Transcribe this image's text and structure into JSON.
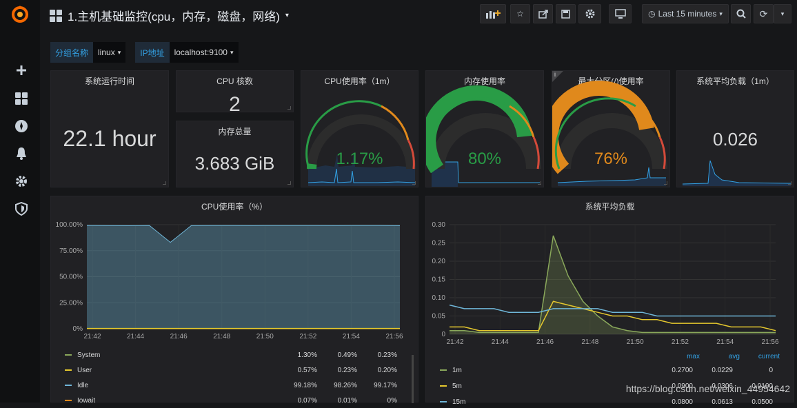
{
  "dashboard": {
    "title": "1.主机基础监控(cpu，内存，磁盘，网络)",
    "time_range": "Last 15 minutes"
  },
  "variables": [
    {
      "label": "分组名称",
      "value": "linux"
    },
    {
      "label": "IP地址",
      "value": "localhost:9100"
    }
  ],
  "stats": {
    "uptime": {
      "title": "系统运行时间",
      "value": "22.1 hour"
    },
    "cpu_count": {
      "title": "CPU 核数",
      "value": "2"
    },
    "mem_total": {
      "title": "内存总量",
      "value": "3.683 GiB"
    },
    "cpu_usage": {
      "title": "CPU使用率（1m）",
      "value": "1.17%",
      "fraction": 0.0117,
      "color": "#299c46"
    },
    "mem_usage": {
      "title": "内存使用率",
      "value": "80%",
      "fraction": 0.8,
      "color": "#299c46"
    },
    "disk_usage": {
      "title": "最大分区(/)使用率",
      "value": "76%",
      "fraction": 0.76,
      "color": "#e0891c"
    },
    "load_avg": {
      "title": "系统平均负载（1m）",
      "value": "0.026"
    }
  },
  "colors": {
    "green": "#299c46",
    "orange": "#e0891c",
    "red": "#d44a3a",
    "blue": "#33a2e5",
    "yellow": "#e5c82e",
    "light_green": "#8aa85b",
    "light_blue": "#6fb6d8"
  },
  "chart_cpu": {
    "title": "CPU使用率（%）",
    "chart_data": {
      "type": "line",
      "x": [
        "21:42",
        "21:44",
        "21:46",
        "21:48",
        "21:50",
        "21:52",
        "21:54",
        "21:56"
      ],
      "ylim": [
        0,
        100
      ],
      "y_ticks": [
        "0%",
        "25.00%",
        "50.00%",
        "75.00%",
        "100.00%"
      ],
      "series": [
        {
          "name": "Idle",
          "values": [
            99.2,
            99.1,
            99.0,
            99.2,
            83,
            99.1,
            99.2,
            99.2,
            99.1,
            99.2,
            99.2,
            99.2,
            99.1,
            99.2,
            99.2,
            99.0
          ],
          "color": "#6fb6d8"
        },
        {
          "name": "System",
          "values": [
            0.3,
            0.3,
            0.3,
            0.3,
            0.3,
            0.3,
            0.3,
            0.3,
            0.3,
            0.3,
            0.3,
            0.3,
            0.3,
            0.3,
            0.3,
            0.3
          ],
          "color": "#8aa85b"
        },
        {
          "name": "User",
          "values": [
            0.2,
            0.2,
            0.2,
            0.2,
            0.2,
            0.2,
            0.2,
            0.2,
            0.2,
            0.2,
            0.2,
            0.2,
            0.2,
            0.2,
            0.2,
            0.2
          ],
          "color": "#e5c82e"
        }
      ]
    },
    "legend": [
      {
        "name": "System",
        "max": "1.30%",
        "avg": "0.49%",
        "current": "0.23%",
        "color": "#8aa85b"
      },
      {
        "name": "User",
        "max": "0.57%",
        "avg": "0.23%",
        "current": "0.20%",
        "color": "#e5c82e"
      },
      {
        "name": "Idle",
        "max": "99.18%",
        "avg": "98.26%",
        "current": "99.17%",
        "color": "#6fb6d8"
      },
      {
        "name": "Iowait",
        "max": "0.07%",
        "avg": "0.01%",
        "current": "0%",
        "color": "#e0891c"
      }
    ]
  },
  "chart_load": {
    "title": "系统平均负载",
    "chart_data": {
      "type": "line",
      "x": [
        "21:42",
        "21:44",
        "21:46",
        "21:48",
        "21:50",
        "21:52",
        "21:54",
        "21:56"
      ],
      "ylim": [
        0,
        0.3
      ],
      "y_ticks": [
        "0",
        "0.05",
        "0.10",
        "0.15",
        "0.20",
        "0.25",
        "0.30"
      ],
      "series": [
        {
          "name": "1m",
          "values": [
            0.01,
            0.01,
            0.005,
            0.005,
            0.005,
            0.005,
            0.005,
            0.27,
            0.16,
            0.09,
            0.05,
            0.02,
            0.01,
            0.005,
            0.005,
            0.005,
            0.005,
            0.005,
            0.005,
            0.005,
            0.005,
            0.005,
            0.005
          ],
          "color": "#8aa85b"
        },
        {
          "name": "5m",
          "values": [
            0.02,
            0.02,
            0.01,
            0.01,
            0.01,
            0.01,
            0.01,
            0.09,
            0.08,
            0.07,
            0.06,
            0.05,
            0.05,
            0.04,
            0.04,
            0.03,
            0.03,
            0.03,
            0.03,
            0.02,
            0.02,
            0.02,
            0.01
          ],
          "color": "#e5c82e"
        },
        {
          "name": "15m",
          "values": [
            0.08,
            0.07,
            0.07,
            0.07,
            0.06,
            0.06,
            0.06,
            0.07,
            0.07,
            0.07,
            0.07,
            0.06,
            0.06,
            0.06,
            0.05,
            0.05,
            0.05,
            0.05,
            0.05,
            0.05,
            0.05,
            0.05,
            0.05
          ],
          "color": "#6fb6d8"
        }
      ]
    },
    "legend_headers": {
      "max": "max",
      "avg": "avg",
      "current": "current"
    },
    "legend": [
      {
        "name": "1m",
        "max": "0.2700",
        "avg": "0.0229",
        "current": "0",
        "color": "#8aa85b"
      },
      {
        "name": "5m",
        "max": "0.0900",
        "avg": "0.0306",
        "current": "0.0100",
        "color": "#e5c82e"
      },
      {
        "name": "15m",
        "max": "0.0800",
        "avg": "0.0613",
        "current": "0.0500",
        "color": "#6fb6d8"
      }
    ]
  },
  "watermark": "https://blog.csdn.net/weixin_44954642"
}
